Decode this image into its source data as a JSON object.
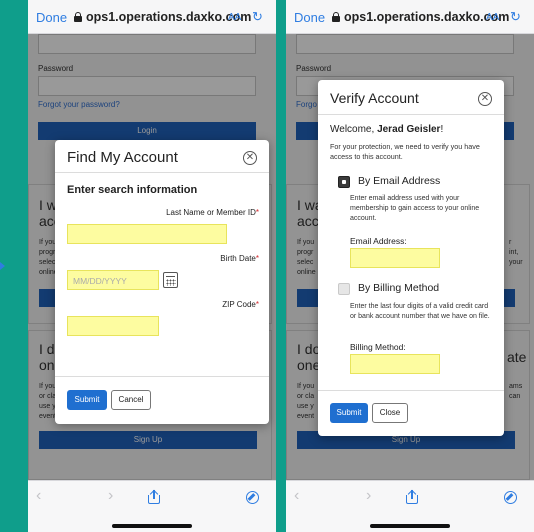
{
  "browser": {
    "done_label": "Done",
    "url": "ops1.operations.daxko.com",
    "text_size_label": "AA",
    "reload_icon": "reload-icon",
    "lock_icon": "lock-icon"
  },
  "background_page": {
    "password_label": "Password",
    "forgot_password": "Forgot your password?",
    "login_button": "Login",
    "card1": {
      "heading_left_1": "I wa",
      "heading_left_2": "acc",
      "body_left": [
        "If you",
        "progr",
        "selec",
        "online"
      ],
      "body_right": [
        "r",
        "int,",
        "your"
      ]
    },
    "card2": {
      "heading_left_1": "I do",
      "heading_left_2": "one",
      "heading_right": "ate",
      "body_left": [
        "If you",
        "or cla",
        "use y",
        "event"
      ],
      "body_right": [
        "ams",
        "can"
      ],
      "signup_button": "Sign Up"
    }
  },
  "find_account_modal": {
    "title": "Find My Account",
    "section_title": "Enter search information",
    "last_name_label": "Last Name or Member ID",
    "birth_date_label": "Birth Date",
    "birth_date_placeholder": "MM/DD/YYYY",
    "zip_label": "ZIP Code",
    "required_mark": "*",
    "submit_label": "Submit",
    "cancel_label": "Cancel"
  },
  "verify_account_modal": {
    "title": "Verify Account",
    "welcome_prefix": "Welcome,",
    "user_name": "Jerad Geisler",
    "welcome_suffix": "!",
    "intro": "For your protection, we need to verify you have access to this account.",
    "email_option": {
      "title": "By Email Address",
      "description": "Enter email address used with your membership to gain access to your online account.",
      "field_label": "Email Address:",
      "selected": true
    },
    "billing_option": {
      "title": "By Billing Method",
      "description": "Enter the last four digits of a valid credit card or bank account number that we have on file.",
      "field_label": "Billing Method:",
      "selected": false
    },
    "submit_label": "Submit",
    "close_label": "Close"
  },
  "bottom_toolbar": {
    "back_icon": "back-icon",
    "forward_icon": "forward-icon",
    "share_icon": "share-icon",
    "compass_icon": "compass-icon"
  },
  "colors": {
    "accent": "#1f6fd0",
    "highlight_fill": "#fdfca0",
    "required": "#d0262b",
    "frame_bg": "#0f9e8b"
  }
}
